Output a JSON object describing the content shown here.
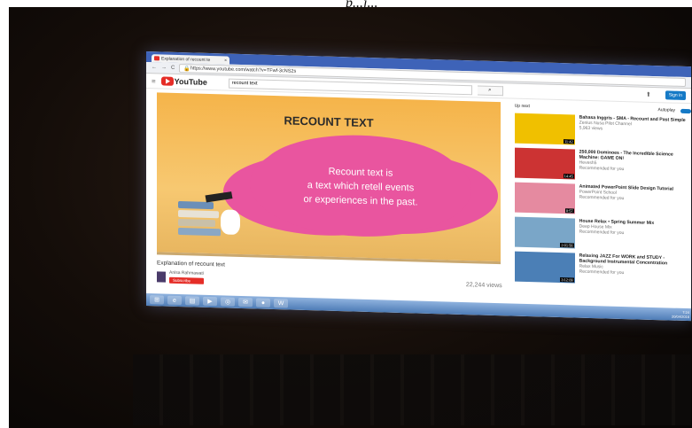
{
  "photo_caption": "p...j...",
  "browser": {
    "tab_title": "Explanation of recount te",
    "url": "https://www.youtube.com/watch?v=TFwf-3cNS2s"
  },
  "youtube": {
    "logo": "YouTube",
    "search_value": "recount text",
    "signin": "Sign in"
  },
  "video": {
    "slide_title": "RECOUNT TEXT",
    "slide_lines": [
      "Recount text is",
      "a text which retell events",
      "or experiences in the past."
    ],
    "name": "Explanation of recount text",
    "channel": "Anisa Rahmawati",
    "subscribe": "Subscribe",
    "views": "22,244 views"
  },
  "sidebar": {
    "up_next": "Up next",
    "autoplay": "Autoplay",
    "items": [
      {
        "title": "Bahasa Inggris - SMA - Recount and Past Simple",
        "meta": "Zenius Nusa Pilot Channel",
        "views": "5,963 views",
        "duration": "11:42",
        "thumb_color": "#f0c000"
      },
      {
        "title": "250,000 Dominoes - The Incredible Science Machine: GAME ON!",
        "meta": "Hevesh5",
        "views": "Recommended for you",
        "duration": "14:45",
        "thumb_color": "#c33"
      },
      {
        "title": "Animated PowerPoint Slide Design Tutorial",
        "meta": "PowerPoint School",
        "views": "Recommended for you",
        "duration": "8:57",
        "thumb_color": "#e58aa0"
      },
      {
        "title": "House Relax • Spring Summer Mix",
        "meta": "Deep House Mix",
        "views": "Recommended for you",
        "duration": "2:01:56",
        "thumb_color": "#7aa6c8"
      },
      {
        "title": "Relaxing JAZZ For WORK and STUDY - Background Instrumental Concentration",
        "meta": "Relax Music",
        "views": "Recommended for you",
        "duration": "3:12:09",
        "thumb_color": "#4b7fb6"
      }
    ]
  },
  "taskbar": {
    "time": "7:24",
    "date": "20/04/2016"
  },
  "colors": {
    "youtube_red": "#e52d27",
    "cloud_pink": "#e9559f",
    "slide_orange": "#f5b44a"
  }
}
